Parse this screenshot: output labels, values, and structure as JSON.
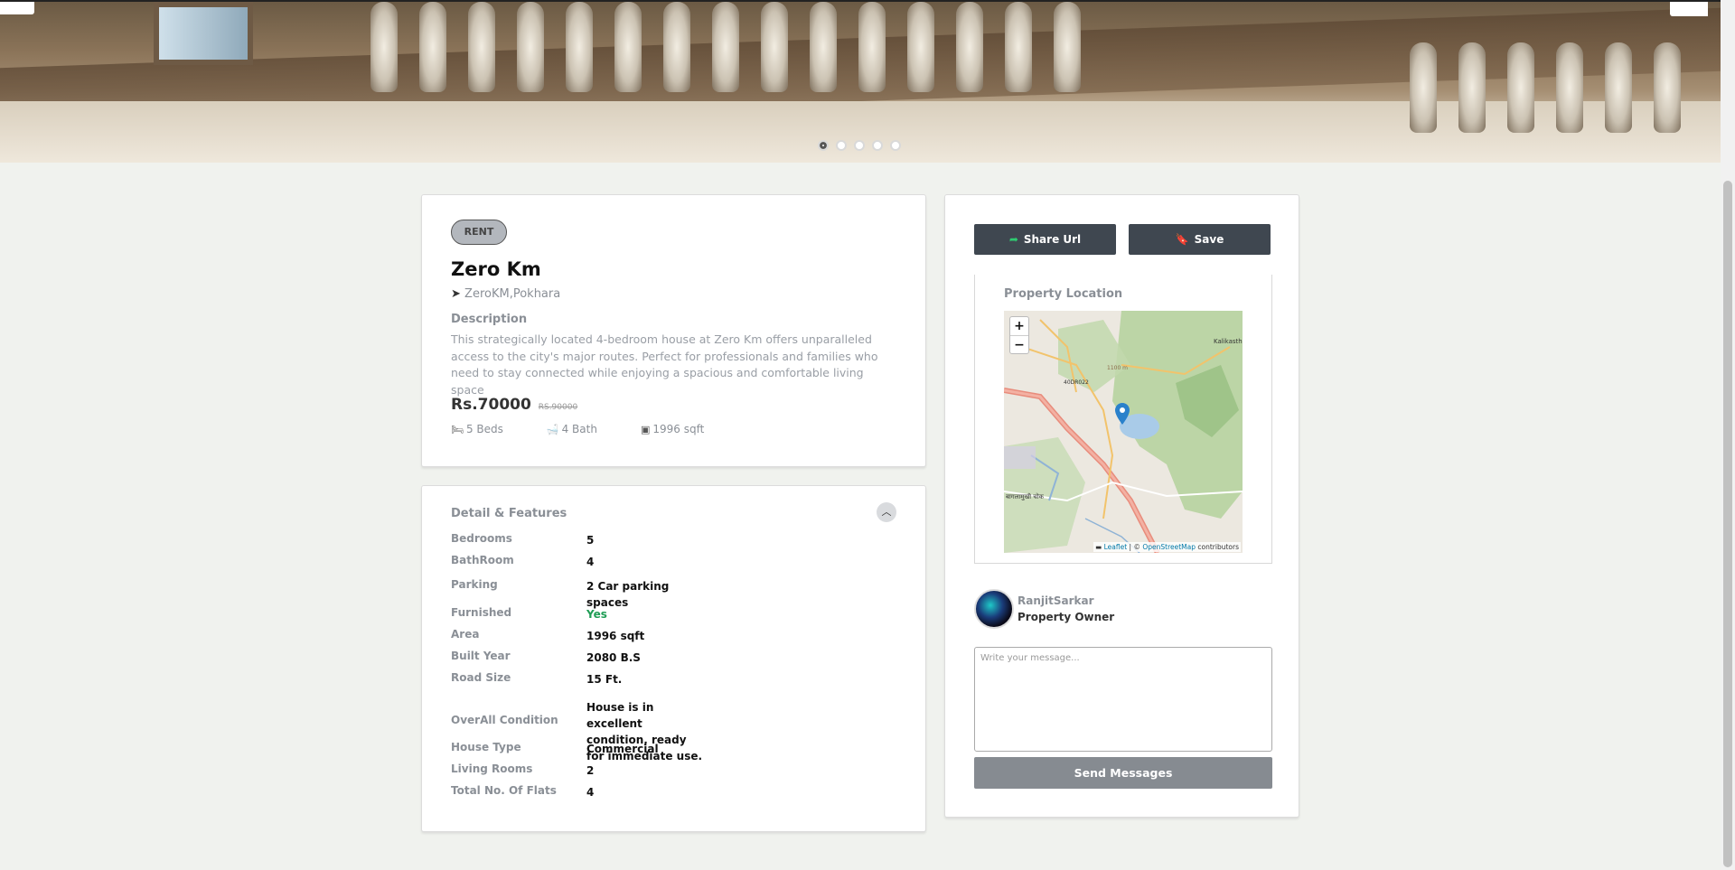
{
  "hero": {
    "slides": 5,
    "active_slide": 1
  },
  "listing": {
    "badge": "RENT",
    "title": "Zero Km",
    "location": "ZeroKM,Pokhara",
    "description_heading": "Description",
    "description": "This strategically located 4-bedroom house at Zero Km offers unparalleled access to the city's major routes. Perfect for professionals and families who need to stay connected while enjoying a spacious and comfortable living space",
    "price": "Rs.70000",
    "old_price": "RS.90000",
    "beds": "5 Beds",
    "bath": "4 Bath",
    "area": "1996 sqft"
  },
  "features": {
    "heading": "Detail & Features",
    "rows": [
      {
        "k": "Bedrooms",
        "v": "5"
      },
      {
        "k": "BathRoom",
        "v": "4"
      },
      {
        "k": "Parking",
        "v": "2 Car parking spaces"
      },
      {
        "k": "Furnished",
        "v": "Yes"
      },
      {
        "k": "Area",
        "v": "1996 sqft"
      },
      {
        "k": "Built Year",
        "v": "2080 B.S"
      },
      {
        "k": "Road Size",
        "v": "15 Ft."
      },
      {
        "k": "OverAll Condition",
        "v": "House is in excellent condition, ready for immediate use."
      },
      {
        "k": "House Type",
        "v": "Commercial"
      },
      {
        "k": "Living Rooms",
        "v": "2"
      },
      {
        "k": "Total No. Of Flats",
        "v": "4"
      }
    ]
  },
  "sidebar": {
    "share_label": "Share Url",
    "save_label": "Save",
    "location_heading": "Property Location",
    "map": {
      "zoom_in": "+",
      "zoom_out": "−",
      "labels": [
        "Kalikasth",
        "1100 m",
        "40DR022",
        "बागलामुखी चोक"
      ],
      "attribution_leaflet": "Leaflet",
      "attribution_sep": "| ©",
      "attribution_osm": "OpenStreetMap",
      "attribution_tail": "contributors"
    },
    "owner_name": "RanjitSarkar",
    "owner_role": "Property Owner",
    "message_placeholder": "Write your message...",
    "send_label": "Send Messages"
  },
  "colors": {
    "furnished_yes": "#1f9d55",
    "dark_button": "#3f4750",
    "send_button": "#868b91",
    "map_marker": "#2a81cb"
  }
}
